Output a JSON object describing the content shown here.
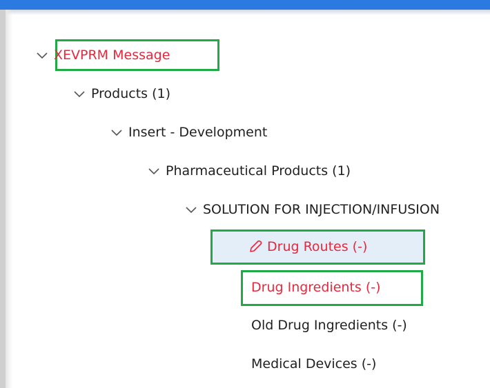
{
  "colors": {
    "accent": "#2a7ae2",
    "highlight": "#1faa46",
    "error_text": "#e8273c",
    "selected_bg": "#e3eef9"
  },
  "tree": {
    "root": {
      "label": "XEVPRM Message",
      "icon": "chevron-down-icon"
    },
    "products": {
      "label": "Products (1)",
      "icon": "chevron-down-icon"
    },
    "insert": {
      "label": "Insert - Development",
      "icon": "chevron-down-icon"
    },
    "pharma": {
      "label": "Pharmaceutical Products (1)",
      "icon": "chevron-down-icon"
    },
    "solution": {
      "label": "SOLUTION FOR INJECTION/INFUSION",
      "icon": "chevron-down-icon"
    },
    "drug_routes": {
      "label": "Drug Routes (-)",
      "icon": "pencil-icon"
    },
    "drug_ingredients": {
      "label": "Drug Ingredients (-)"
    },
    "old_drug_ingredients": {
      "label": "Old Drug Ingredients (-)"
    },
    "medical_devices": {
      "label": "Medical Devices (-)"
    }
  }
}
